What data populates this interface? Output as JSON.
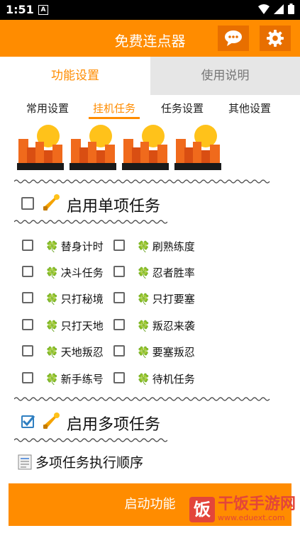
{
  "status_bar": {
    "time": "1:51",
    "notification_letter": "A"
  },
  "app": {
    "title": "免费连点器"
  },
  "tabs": [
    {
      "label": "功能设置"
    },
    {
      "label": "使用说明"
    }
  ],
  "subtabs": [
    {
      "label": "常用设置"
    },
    {
      "label": "挂机任务"
    },
    {
      "label": "任务设置"
    },
    {
      "label": "其他设置"
    }
  ],
  "sections": {
    "single": {
      "label": "启用单项任务",
      "checked": false
    },
    "multi": {
      "label": "启用多项任务",
      "checked": true
    }
  },
  "tasks": [
    {
      "label": "替身计时",
      "checked": false
    },
    {
      "label": "刷熟练度",
      "checked": false
    },
    {
      "label": "决斗任务",
      "checked": false
    },
    {
      "label": "忍者胜率",
      "checked": false
    },
    {
      "label": "只打秘境",
      "checked": false
    },
    {
      "label": "只打要塞",
      "checked": false
    },
    {
      "label": "只打天地",
      "checked": false
    },
    {
      "label": "叛忍来袭",
      "checked": false
    },
    {
      "label": "天地叛忍",
      "checked": false
    },
    {
      "label": "要塞叛忍",
      "checked": false
    },
    {
      "label": "新手练号",
      "checked": false
    },
    {
      "label": "待机任务",
      "checked": false
    }
  ],
  "order_label": "多项任务执行顺序",
  "start_button": "启动功能",
  "watermark": {
    "logo": "饭",
    "text": "干饭手游网",
    "url": "www.eduext.com"
  },
  "colors": {
    "accent": "#ff8c00",
    "accent_dark": "#e86f00",
    "check": "#2f7fc1"
  }
}
